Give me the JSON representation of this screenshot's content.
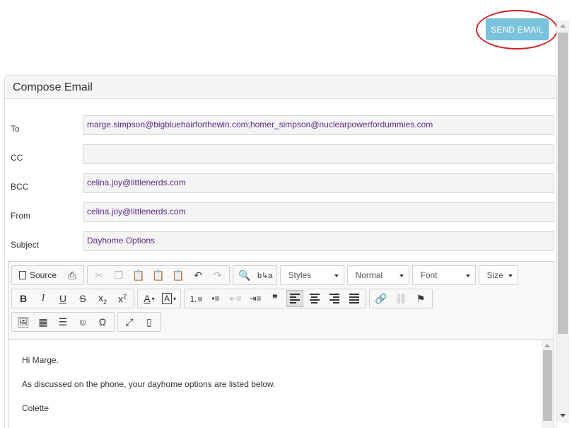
{
  "header": {
    "send_label": "SEND EMAIL"
  },
  "panel": {
    "title": "Compose Email"
  },
  "fields": [
    {
      "label": "To",
      "value": "marge.simpson@bigbluehairforthewin.com;homer_simpson@nuclearpowerfordummies.com"
    },
    {
      "label": "CC",
      "value": ""
    },
    {
      "label": "BCC",
      "value": "celina.joy@littlenerds.com"
    },
    {
      "label": "From",
      "value": "celina.joy@littlenerds.com"
    },
    {
      "label": "Subject",
      "value": "Dayhome Options"
    }
  ],
  "toolbar": {
    "source_label": "Source",
    "styles": "Styles",
    "format": "Normal",
    "font": "Font",
    "size": "Size"
  },
  "body": {
    "lines": [
      "Hi Marge.",
      "As discussed on the phone, your dayhome options are listed below.",
      "Colette"
    ]
  },
  "colors": {
    "send_button": "#79c3dd",
    "highlight": "#d42128",
    "field_text": "#5a2a86"
  }
}
